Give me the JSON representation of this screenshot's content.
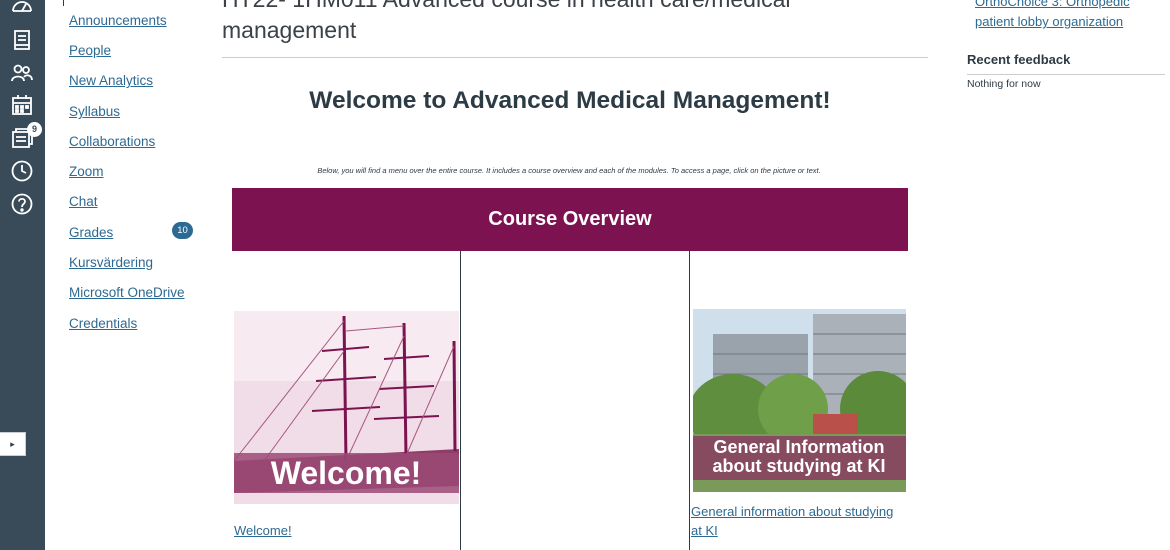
{
  "global_nav": {
    "icons": [
      "dashboard-icon",
      "courses-icon",
      "groups-icon",
      "calendar-icon",
      "inbox-icon",
      "history-icon",
      "help-icon"
    ],
    "inbox_badge": "9",
    "collapse_label": "▸"
  },
  "course_nav": {
    "items": [
      {
        "label": "Announcements"
      },
      {
        "label": "People"
      },
      {
        "label": "New Analytics"
      },
      {
        "label": "Syllabus"
      },
      {
        "label": "Collaborations"
      },
      {
        "label": "Zoom"
      },
      {
        "label": "Chat"
      },
      {
        "label": "Grades"
      },
      {
        "label": "Kursvärdering"
      },
      {
        "label": "Microsoft OneDrive"
      },
      {
        "label": "Credentials"
      }
    ],
    "grades_badge": "10"
  },
  "main": {
    "course_title": "HT22- 1HM011 Advanced course in health care/medical management",
    "welcome_heading": "Welcome to Advanced Medical Management!",
    "intro_text": "Below, you will find a menu over the entire course. It includes a course overview and each of the modules.  To access a page, click on the picture or text.",
    "overview_banner": "Course Overview",
    "modules": [
      {
        "image_text": "Welcome!",
        "link": "Welcome!"
      },
      {
        "image_text_line1": "General Information",
        "image_text_line2": "about studying at KI",
        "link": "General information about studying at KI"
      }
    ]
  },
  "sidebar": {
    "todo_link": "OrthoChoice 3: Orthopedic patient lobby organization",
    "recent_feedback_title": "Recent feedback",
    "recent_feedback_empty": "Nothing for now"
  },
  "colors": {
    "nav_bg": "#394b58",
    "link": "#2d6a93",
    "banner": "#7d1250",
    "text": "#2d3b45"
  }
}
